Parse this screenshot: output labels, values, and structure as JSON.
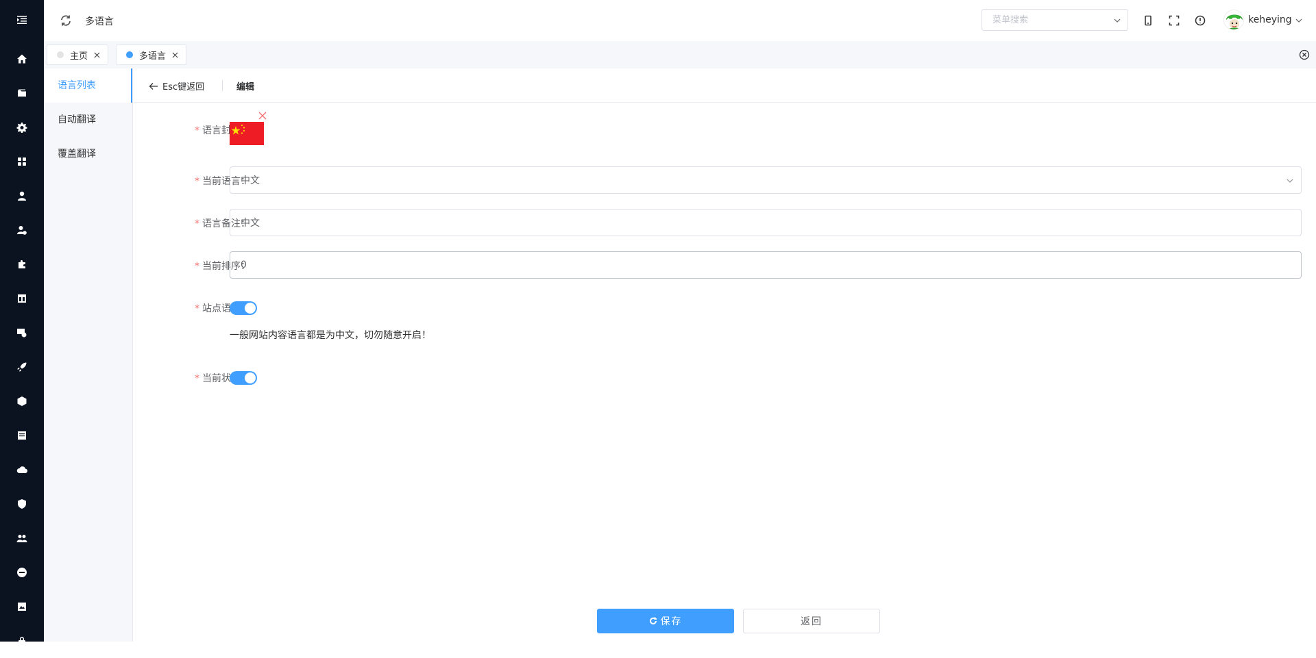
{
  "header": {
    "page_title": "多语言",
    "menu_search_placeholder": "菜单搜索",
    "username": "keheying"
  },
  "rail_icons": [
    "menu-fold-icon",
    "home-icon",
    "folder-icon",
    "gear-icon",
    "apps-icon",
    "user-icon",
    "user-settings-icon",
    "plugin-icon",
    "layout-icon",
    "image-icon",
    "rocket-icon",
    "cube-icon",
    "document-icon",
    "cloud-upload-icon",
    "shield-icon",
    "team-icon",
    "minus-circle-icon",
    "gallery-icon",
    "lock-icon"
  ],
  "tabs": [
    {
      "label": "主页",
      "dot_color": "#e4e4e4"
    },
    {
      "label": "多语言",
      "dot_color": "#409eff"
    }
  ],
  "subnav": {
    "items": [
      {
        "label": "语言列表",
        "active": true
      },
      {
        "label": "自动翻译",
        "active": false
      },
      {
        "label": "覆盖翻译",
        "active": false
      }
    ]
  },
  "page_header": {
    "back_label": "Esc键返回",
    "title": "编辑"
  },
  "form": {
    "cover_label": "语言封面：",
    "language_label": "当前语言：",
    "language_value": "中文",
    "remark_label": "语言备注：",
    "remark_value": "中文",
    "sort_label": "当前排序：",
    "sort_value": "0",
    "site_lang_label": "站点语言：",
    "site_lang_on": true,
    "site_lang_hint": "一般网站内容语言都是为中文，切勿随意开启！",
    "status_label": "当前状态：",
    "status_on": true
  },
  "buttons": {
    "save": "保存",
    "back": "返回"
  },
  "colors": {
    "primary": "#409eff",
    "rail_bg": "#0b1320",
    "required": "#f56c6c",
    "flag_red": "#ee1c25",
    "flag_yellow": "#ffde00"
  }
}
